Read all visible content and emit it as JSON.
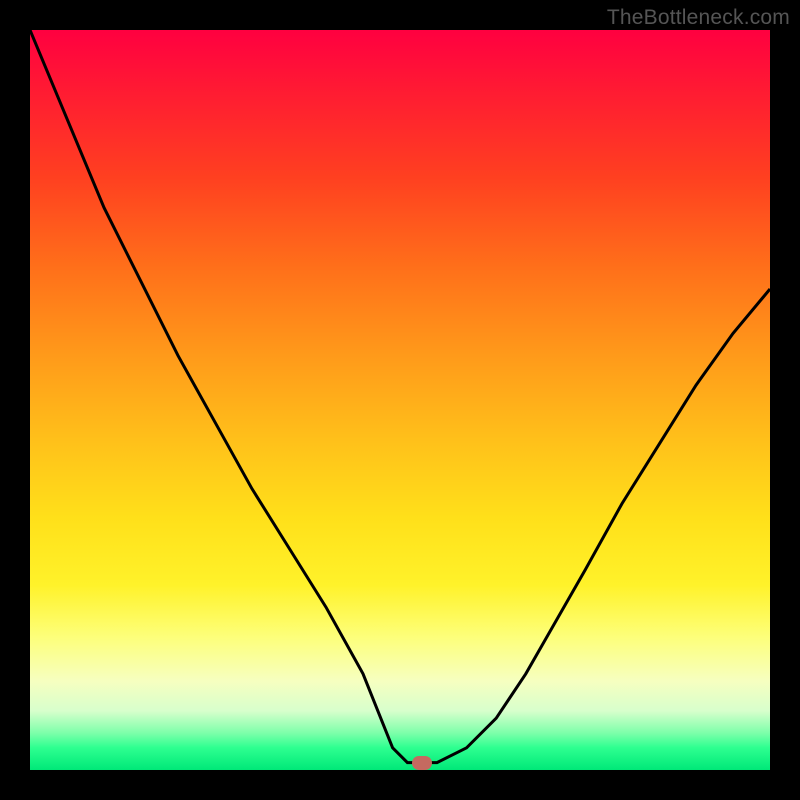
{
  "watermark": "TheBottleneck.com",
  "colors": {
    "curve_stroke": "#000000",
    "marker_fill": "#c56a60"
  },
  "chart_data": {
    "type": "line",
    "title": "",
    "xlabel": "",
    "ylabel": "",
    "xlim": [
      0,
      100
    ],
    "ylim": [
      0,
      100
    ],
    "grid": false,
    "legend": false,
    "series": [
      {
        "name": "bottleneck-curve",
        "x": [
          0,
          5,
          10,
          15,
          20,
          25,
          30,
          35,
          40,
          45,
          47,
          49,
          51,
          53,
          55,
          59,
          63,
          67,
          71,
          75,
          80,
          85,
          90,
          95,
          100
        ],
        "values": [
          100,
          88,
          76,
          66,
          56,
          47,
          38,
          30,
          22,
          13,
          8,
          3,
          1,
          1,
          1,
          3,
          7,
          13,
          20,
          27,
          36,
          44,
          52,
          59,
          65
        ]
      }
    ],
    "marker": {
      "x": 53,
      "y": 1
    },
    "annotations": []
  }
}
